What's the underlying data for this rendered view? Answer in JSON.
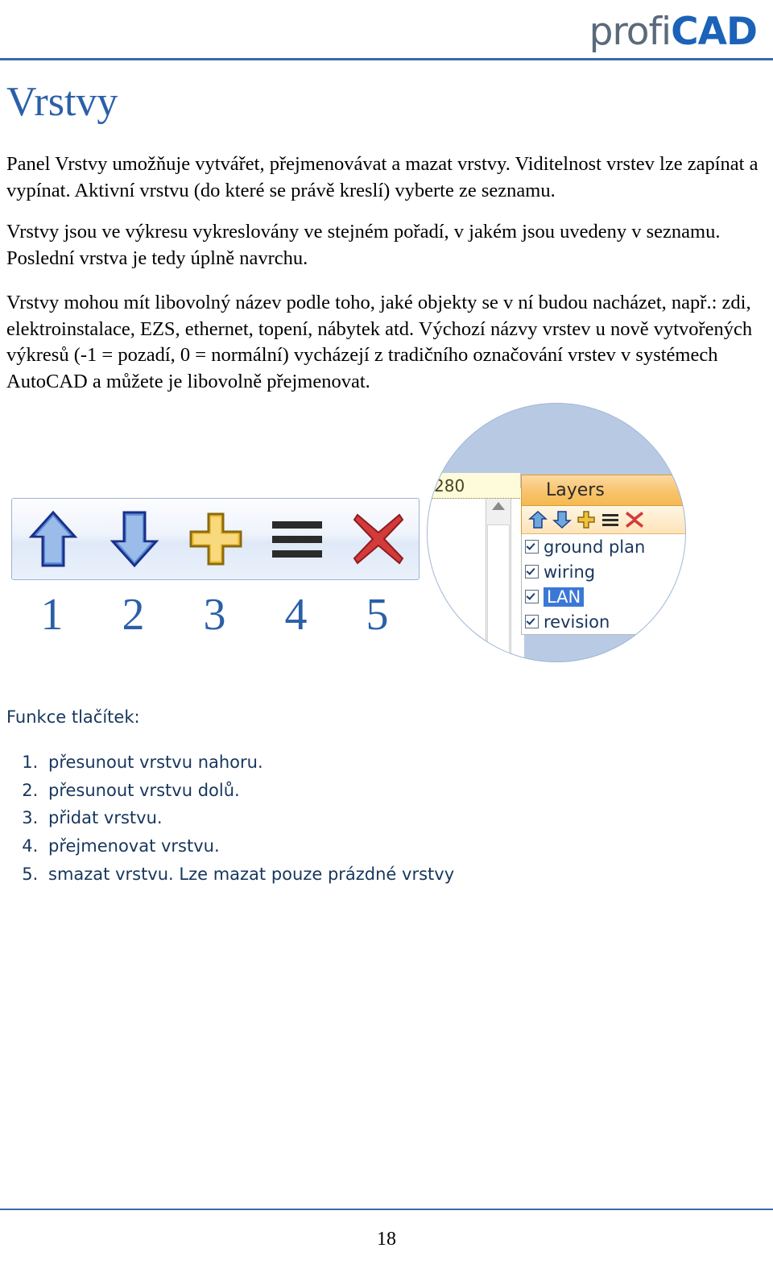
{
  "logo": {
    "part1": "profi",
    "part2": "CAD"
  },
  "title": "Vrstvy",
  "paragraphs": {
    "p1": "Panel Vrstvy umožňuje vytvářet, přejmenovávat a mazat vrstvy. Viditelnost vrstev lze zapínat a vypínat. Aktivní vrstvu (do které se právě kreslí) vyberte ze seznamu.",
    "p2": "Vrstvy jsou ve výkresu vykreslovány ve stejném pořadí, v jakém jsou uvedeny v seznamu. Poslední vrstva je tedy úplně navrchu.",
    "p3": "Vrstvy mohou mít libovolný název podle toho, jaké objekty se v ní budou nacházet, např.: zdi, elektroinstalace, EZS, ethernet, topení, nábytek atd. Výchozí názvy vrstev u nově vytvořených výkresů (-1 = pozadí, 0 = normální) vycházejí z tradičního označování vrstev v systémech AutoCAD a můžete je libovolně přejmenovat."
  },
  "toolbar": {
    "buttons": [
      {
        "icon": "arrow-up-icon",
        "number": "1"
      },
      {
        "icon": "arrow-down-icon",
        "number": "2"
      },
      {
        "icon": "plus-icon",
        "number": "3"
      },
      {
        "icon": "rename-lines-icon",
        "number": "4"
      },
      {
        "icon": "delete-x-icon",
        "number": "5"
      }
    ]
  },
  "inset": {
    "ruler_value": "280",
    "panel_title": "Layers",
    "toolbar_icons": [
      "arrow-up-icon",
      "arrow-down-icon",
      "plus-icon",
      "rename-lines-icon",
      "delete-x-icon"
    ],
    "layers": [
      {
        "label": "ground plan",
        "checked": true,
        "selected": false
      },
      {
        "label": "wiring",
        "checked": true,
        "selected": false
      },
      {
        "label": "LAN",
        "checked": true,
        "selected": true
      },
      {
        "label": "revision",
        "checked": true,
        "selected": false
      }
    ]
  },
  "lower": {
    "heading": "Funkce tlačítek:",
    "items": [
      "přesunout vrstvu nahoru.",
      "přesunout vrstvu dolů.",
      "přidat vrstvu.",
      "přejmenovat vrstvu.",
      "smazat vrstvu. Lze mazat pouze prázdné vrstvy"
    ]
  },
  "footer": {
    "page_number": "18"
  }
}
